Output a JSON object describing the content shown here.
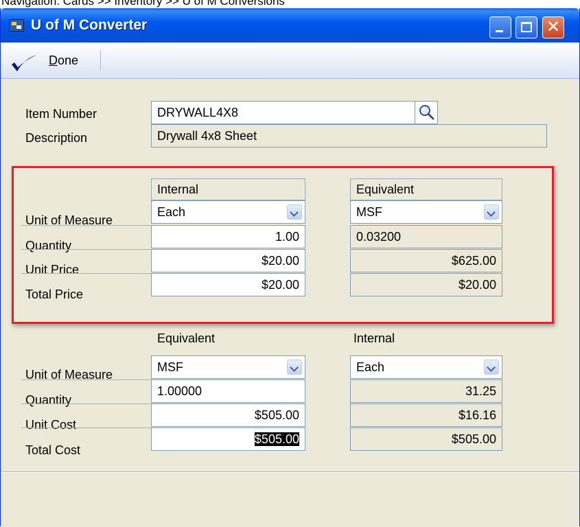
{
  "caption": "Navigation: Cards >> Inventory >> U of M Conversions",
  "window": {
    "title": "U of M Converter"
  },
  "toolbar": {
    "done_label": "Done"
  },
  "item": {
    "number_label": "Item Number",
    "number_value": "DRYWALL4X8",
    "description_label": "Description",
    "description_value": "Drywall 4x8 Sheet"
  },
  "price_section": {
    "left_header": "Internal",
    "right_header": "Equivalent",
    "rows": [
      {
        "label": "Unit of Measure",
        "left": "Each",
        "right": "MSF"
      },
      {
        "label": "Quantity",
        "left": "1.00",
        "right": "0.03200"
      },
      {
        "label": "Unit Price",
        "left": "$20.00",
        "right": "$625.00"
      },
      {
        "label": "Total Price",
        "left": "$20.00",
        "right": "$20.00"
      }
    ]
  },
  "cost_section": {
    "left_header": "Equivalent",
    "right_header": "Internal",
    "rows": [
      {
        "label": "Unit of Measure",
        "left": "MSF",
        "right": "Each"
      },
      {
        "label": "Quantity",
        "left": "1.00000",
        "right": "31.25"
      },
      {
        "label": "Unit Cost",
        "left": "$505.00",
        "right": "$16.16"
      },
      {
        "label": "Total Cost",
        "left": "$505.00",
        "right": "$505.00"
      }
    ]
  },
  "icons": {
    "app": "app-icon",
    "done": "checkmark-icon",
    "lookup": "magnifier-icon",
    "dropdown": "chevron-down-icon"
  },
  "colors": {
    "titlebar": "#0058ee",
    "highlight": "#e8202a",
    "window_bg": "#ece9d8"
  }
}
